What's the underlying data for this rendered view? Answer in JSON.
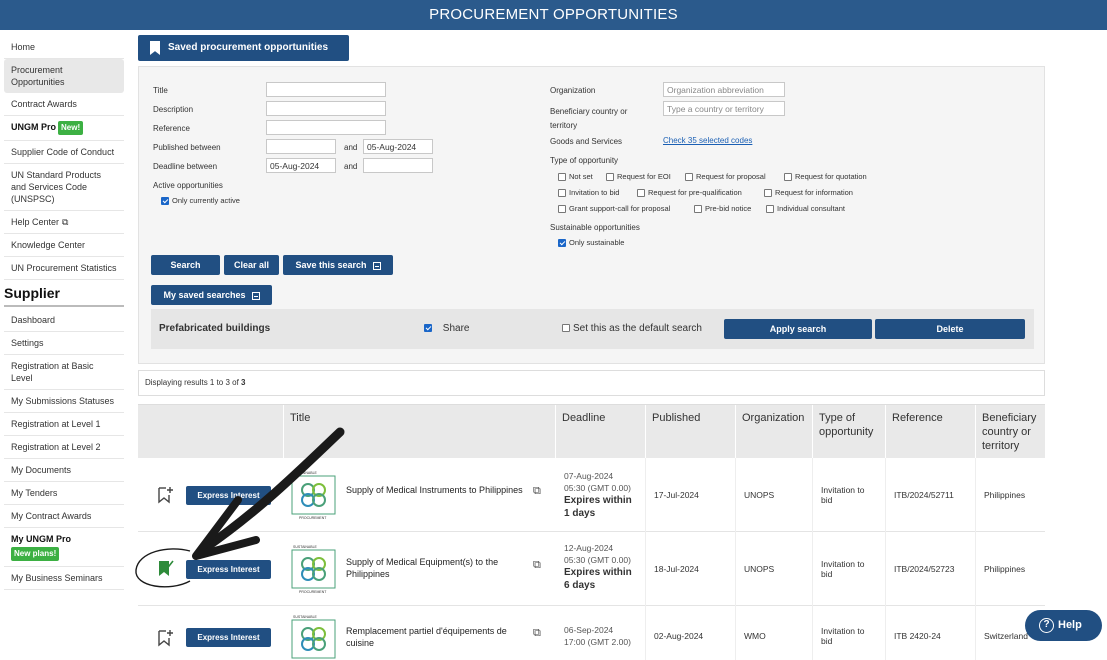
{
  "header": {
    "title": "PROCUREMENT OPPORTUNITIES"
  },
  "sidebar": {
    "items": [
      {
        "label": "Home"
      },
      {
        "label": "Procurement Opportunities",
        "active": true
      },
      {
        "label": "Contract Awards"
      },
      {
        "label": "UNGM Pro",
        "badge": "New!"
      },
      {
        "label": "Supplier Code of Conduct"
      },
      {
        "label": "UN Standard Products and Services Code (UNSPSC)"
      },
      {
        "label": "Help Center"
      },
      {
        "label": "Knowledge Center"
      },
      {
        "label": "UN Procurement Statistics"
      }
    ],
    "section": "Supplier",
    "supplier_items": [
      {
        "label": "Dashboard"
      },
      {
        "label": "Settings"
      },
      {
        "label": "Registration at Basic Level"
      },
      {
        "label": "My Submissions Statuses"
      },
      {
        "label": "Registration at Level 1"
      },
      {
        "label": "Registration at Level 2"
      },
      {
        "label": "My Documents"
      },
      {
        "label": "My Tenders"
      },
      {
        "label": "My Contract Awards"
      },
      {
        "label": "My UNGM Pro",
        "badge": "New plans!"
      },
      {
        "label": "My Business Seminars"
      }
    ]
  },
  "saved_button": "Saved procurement opportunities",
  "form": {
    "title_label": "Title",
    "description_label": "Description",
    "reference_label": "Reference",
    "published_label": "Published between",
    "and1": "and",
    "published_to": "05-Aug-2024",
    "deadline_label": "Deadline between",
    "deadline_from": "05-Aug-2024",
    "and2": "and",
    "active_label": "Active opportunities",
    "only_active": "Only currently active",
    "organization_label": "Organization",
    "organization_placeholder": "Organization abbreviation",
    "beneficiary_label": "Beneficiary country or territory",
    "beneficiary_placeholder": "Type a country or territory",
    "goods_label": "Goods and Services",
    "goods_link": "Check 35 selected codes",
    "type_label": "Type of opportunity",
    "types": [
      "Not set",
      "Request for EOI",
      "Request for proposal",
      "Request for quotation",
      "Invitation to bid",
      "Request for pre-qualification",
      "Request for information",
      "Grant support-call for proposal",
      "Pre-bid notice",
      "Individual consultant"
    ],
    "sustainable_label": "Sustainable opportunities",
    "only_sustainable": "Only sustainable"
  },
  "buttons": {
    "search": "Search",
    "clear": "Clear all",
    "save_search": "Save this search",
    "my_saved": "My saved searches"
  },
  "saved_search": {
    "name": "Prefabricated buildings",
    "share": "Share",
    "default": "Set this as the default search",
    "apply": "Apply search",
    "delete": "Delete"
  },
  "results": {
    "pre": "Displaying results 1 to 3 of ",
    "total": "3"
  },
  "table": {
    "headers": [
      "Title",
      "Deadline",
      "Published",
      "Organization",
      "Type of opportunity",
      "Reference",
      "Beneficiary country or territory"
    ],
    "rows": [
      {
        "express": "Express Interest",
        "title": "Supply of Medical Instruments to Philippines",
        "deadline_date": "07-Aug-2024",
        "deadline_time": "05:30 (GMT 0.00)",
        "expires": "Expires within 1 days",
        "published": "17-Jul-2024",
        "organization": "UNOPS",
        "type": "Invitation to bid",
        "reference": "ITB/2024/52711",
        "country": "Philippines",
        "saved": false
      },
      {
        "express": "Express Interest",
        "title": "Supply of Medical Equipment(s) to the Philippines",
        "deadline_date": "12-Aug-2024",
        "deadline_time": "05:30 (GMT 0.00)",
        "expires": "Expires within 6 days",
        "published": "18-Jul-2024",
        "organization": "UNOPS",
        "type": "Invitation to bid",
        "reference": "ITB/2024/52723",
        "country": "Philippines",
        "saved": true
      },
      {
        "express": "Express Interest",
        "title": "Remplacement partiel d'équipements de cuisine",
        "deadline_date": "06-Sep-2024",
        "deadline_time": "17:00 (GMT 2.00)",
        "expires": "",
        "published": "02-Aug-2024",
        "organization": "WMO",
        "type": "Invitation to bid",
        "reference": "ITB 2420-24",
        "country": "Switzerland",
        "saved": false
      }
    ]
  },
  "logo_text": {
    "top": "SUSTAINABLE",
    "bottom": "PROCUREMENT"
  },
  "help": "Help"
}
